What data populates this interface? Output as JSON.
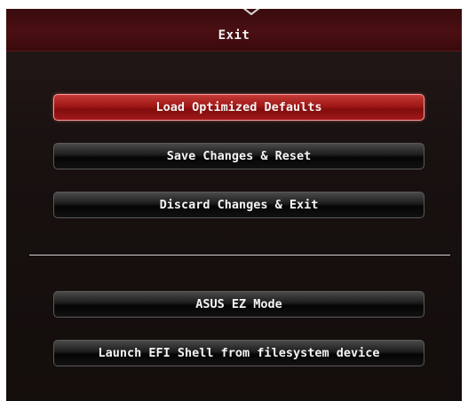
{
  "dialog": {
    "title": "Exit"
  },
  "buttons": [
    {
      "label": "Load Optimized Defaults",
      "state": "selected"
    },
    {
      "label": "Save Changes & Reset",
      "state": "normal"
    },
    {
      "label": "Discard Changes & Exit",
      "state": "normal"
    },
    {
      "label": "ASUS EZ Mode",
      "state": "normal"
    },
    {
      "label": "Launch EFI Shell from filesystem device",
      "state": "normal"
    }
  ],
  "colors": {
    "title_bar": "#4a0f12",
    "selected_button": "#a01717",
    "button": "#111111",
    "panel": "#181110",
    "divider": "#cfcfcf"
  }
}
